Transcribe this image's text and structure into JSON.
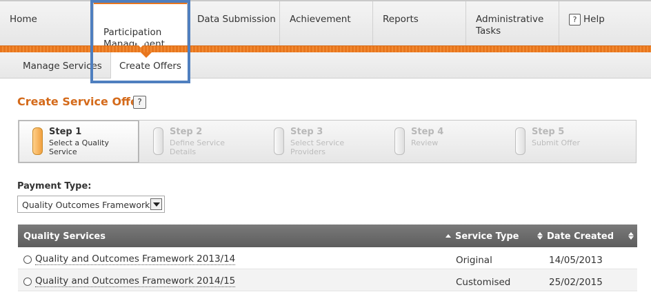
{
  "nav": {
    "tabs": [
      {
        "label": "Home"
      },
      {
        "label": "Participation\nManagement"
      },
      {
        "label": "Data Submission"
      },
      {
        "label": "Achievement"
      },
      {
        "label": "Reports"
      },
      {
        "label": "Administrative\nTasks"
      },
      {
        "label": "Help",
        "icon": "help-icon",
        "icon_glyph": "?"
      }
    ]
  },
  "subnav": {
    "tabs": [
      {
        "label": "Manage Services"
      },
      {
        "label": "Create Offers"
      }
    ]
  },
  "page": {
    "title": "Create Service Offer",
    "help_glyph": "?"
  },
  "wizard": {
    "steps": [
      {
        "title": "Step 1",
        "subtitle": "Select a Quality Service"
      },
      {
        "title": "Step 2",
        "subtitle": "Define Service Details"
      },
      {
        "title": "Step 3",
        "subtitle": "Select Service Providers"
      },
      {
        "title": "Step 4",
        "subtitle": "Review"
      },
      {
        "title": "Step 5",
        "subtitle": "Submit Offer"
      }
    ],
    "active_step": 1
  },
  "payment": {
    "label": "Payment Type:",
    "selected": "Quality Outcomes Framework"
  },
  "table": {
    "headers": {
      "name": "Quality Services",
      "type": "Service Type",
      "date": "Date Created"
    },
    "rows": [
      {
        "name": "Quality and Outcomes Framework 2013/14",
        "type": "Original",
        "date": "14/05/2013"
      },
      {
        "name": "Quality and Outcomes Framework 2014/15",
        "type": "Customised",
        "date": "25/02/2015"
      }
    ]
  },
  "colors": {
    "accent": "#e8761d",
    "title": "#d46a1a",
    "highlight": "#4f7fbf",
    "table_header": "#6a6a6a"
  }
}
